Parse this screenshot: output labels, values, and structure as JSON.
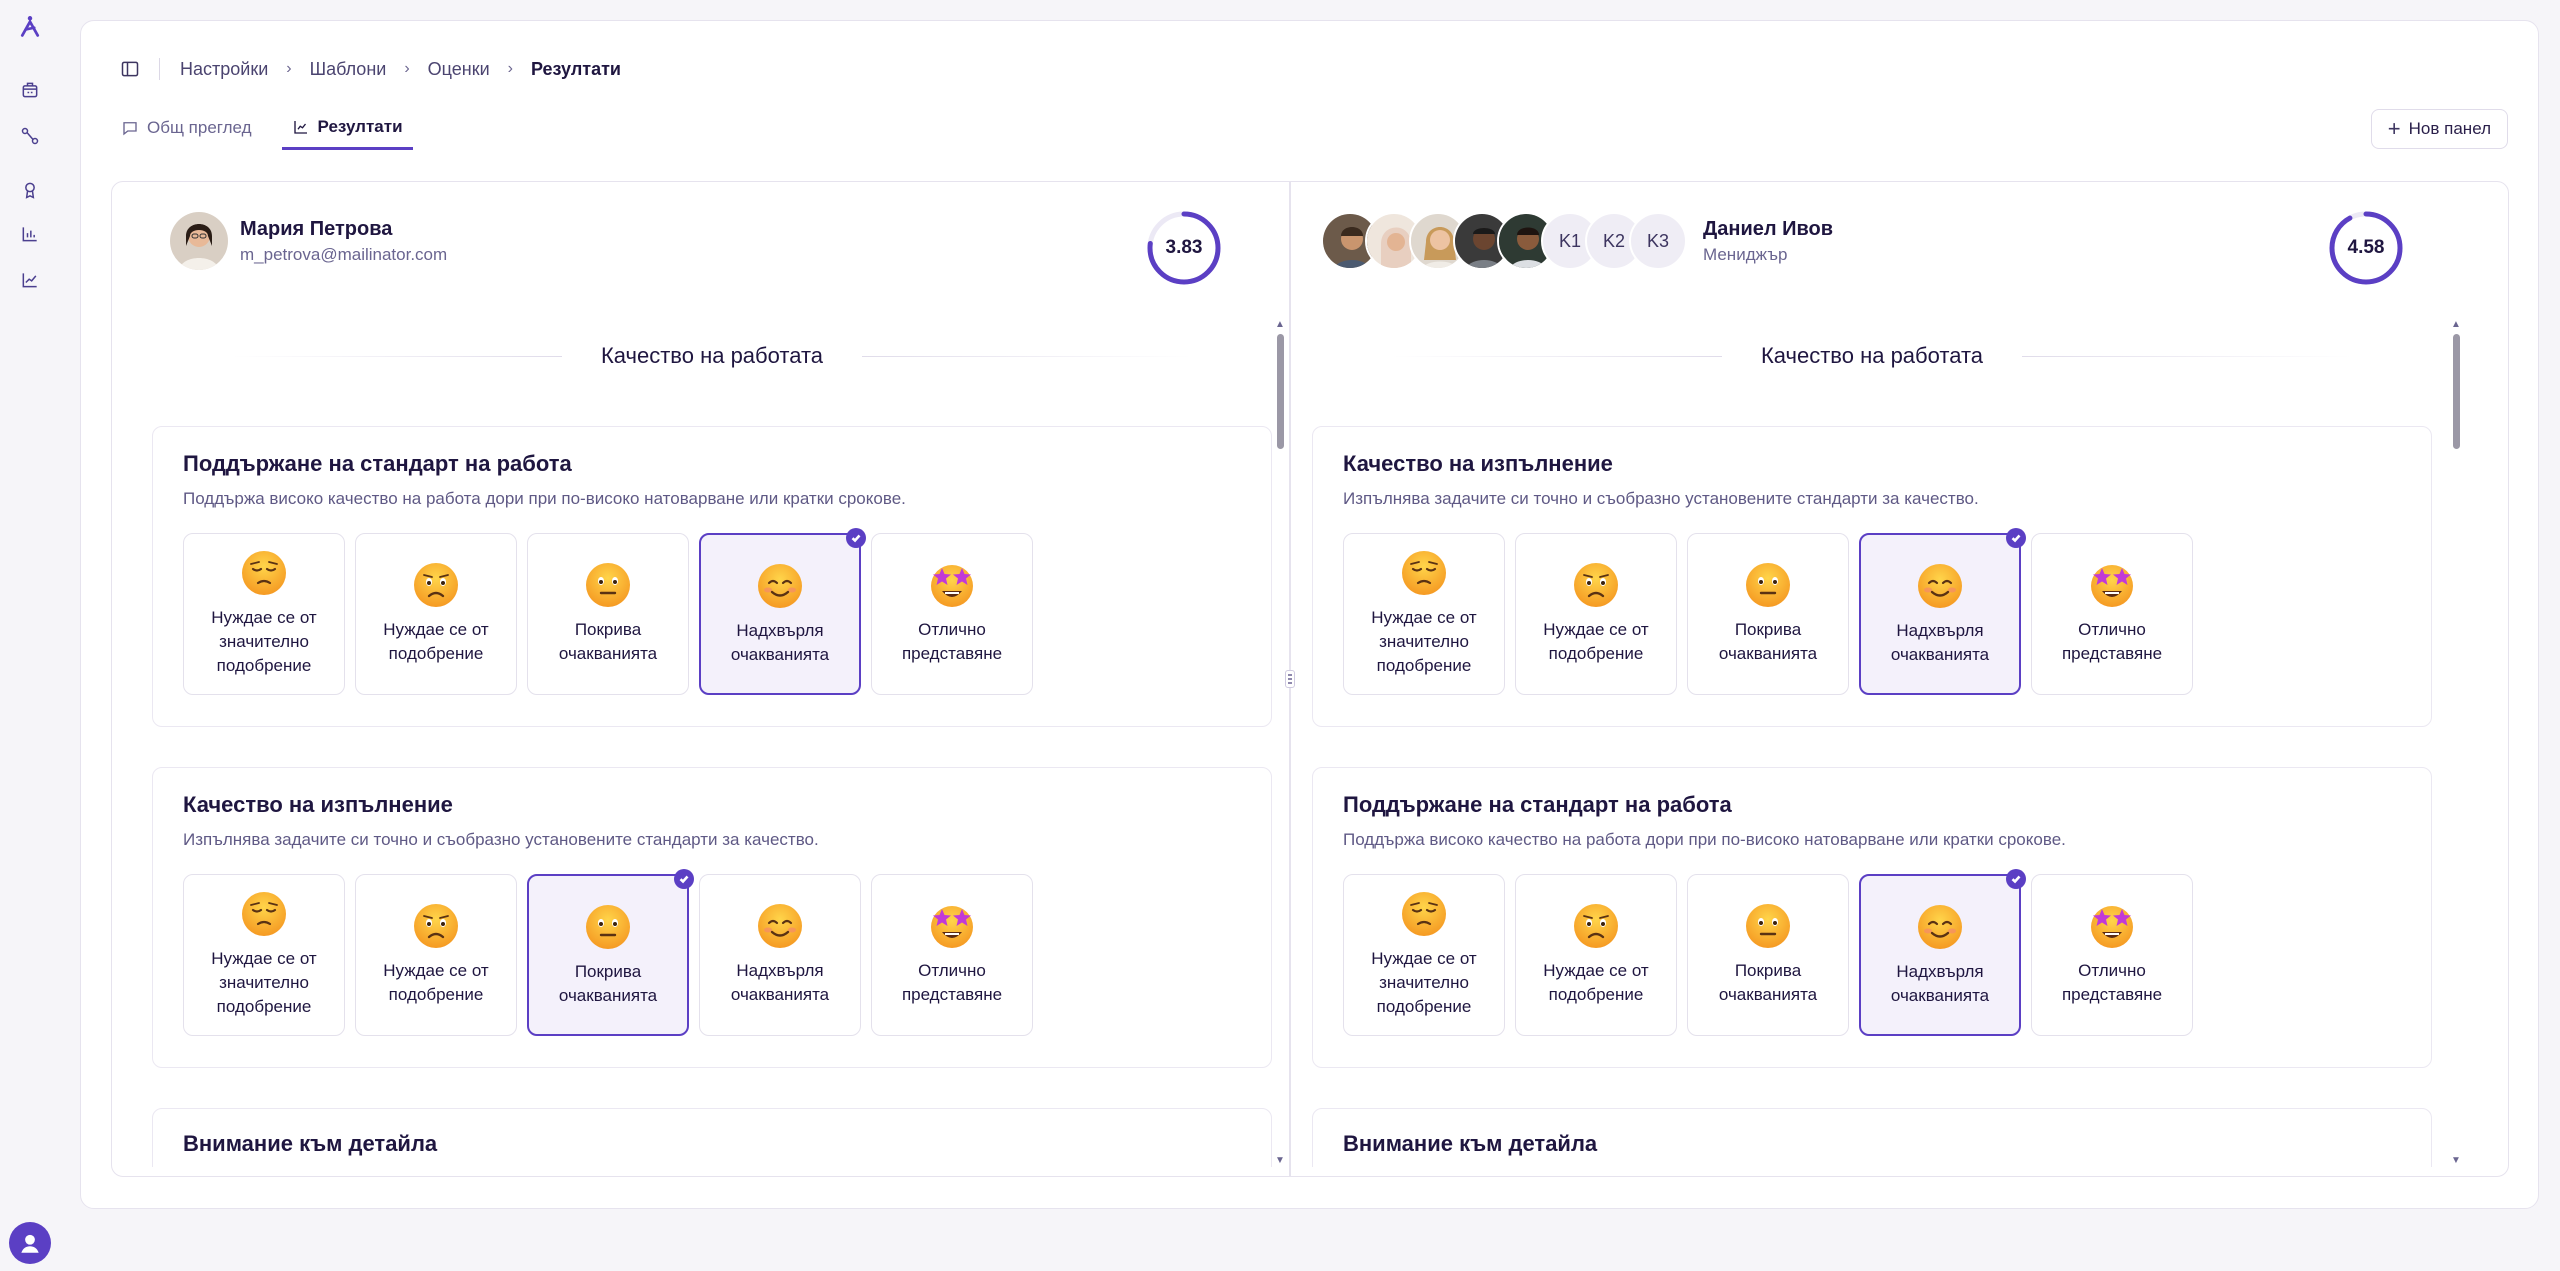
{
  "app": {
    "brand_color": "#5b3fc4",
    "rail_icons": [
      "logo-icon",
      "building-icon",
      "route-icon",
      "award-icon",
      "bar-chart-icon",
      "trend-chart-icon",
      "user-avatar-icon"
    ]
  },
  "breadcrumb": [
    "Настройки",
    "Шаблони",
    "Оценки",
    "Резултати"
  ],
  "tabs": [
    {
      "label": "Общ преглед",
      "icon": "message-square-icon",
      "active": false
    },
    {
      "label": "Резултати",
      "icon": "chart-icon",
      "active": true
    }
  ],
  "new_panel_label": "Нов панел",
  "left_panel": {
    "name": "Мария Петрова",
    "email": "m_petrova@mailinator.com",
    "score": "3.83",
    "score_fraction": 0.77,
    "section_title": "Качество на работата",
    "questions": [
      {
        "title": "Поддържане на стандарт на работа",
        "description": "Поддържа високо качество на работа дори при по-високо натоварване или кратки срокове.",
        "selected": 3
      },
      {
        "title": "Качество на изпълнение",
        "description": "Изпълнява задачите си точно и съобразно установените стандарти за качество.",
        "selected": 2
      }
    ],
    "next_question_title": "Внимание към детайла"
  },
  "right_panel": {
    "name": "Даниел Ивов",
    "role": "Мениджър",
    "initials": [
      "K1",
      "K2",
      "K3"
    ],
    "score": "4.58",
    "score_fraction": 0.92,
    "section_title": "Качество на работата",
    "questions": [
      {
        "title": "Качество на изпълнение",
        "description": "Изпълнява задачите си точно и съобразно установените стандарти за качество.",
        "selected": 3
      },
      {
        "title": "Поддържане на стандарт на работа",
        "description": "Поддържа високо качество на работа дори при по-високо натоварване или кратки срокове.",
        "selected": 3
      }
    ],
    "next_question_title": "Внимание към детайла"
  },
  "rating_options": [
    {
      "label": "Нуждае се от значително подобрение",
      "emoji": "pensive-face-icon"
    },
    {
      "label": "Нуждае се от подобрение",
      "emoji": "worried-face-icon"
    },
    {
      "label": "Покрива очакванията",
      "emoji": "neutral-face-icon"
    },
    {
      "label": "Надхвърля очакванията",
      "emoji": "smiling-face-icon"
    },
    {
      "label": "Отлично представяне",
      "emoji": "star-struck-face-icon"
    }
  ]
}
